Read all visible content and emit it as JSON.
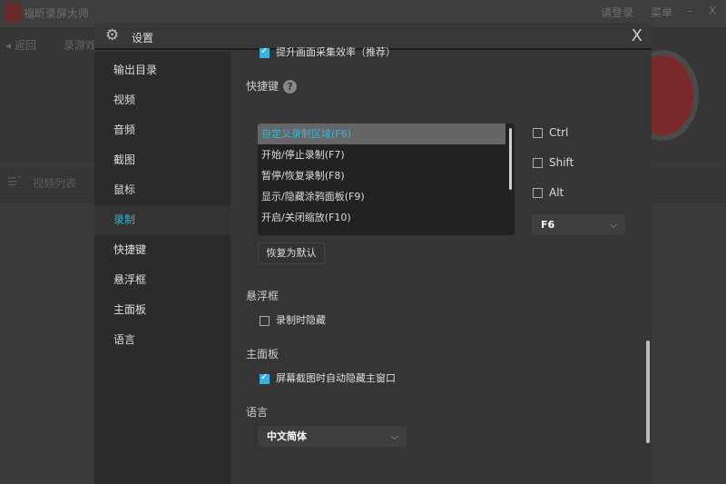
{
  "app": {
    "title": "福昕录屏大师",
    "login": "请登录",
    "menu": "菜单",
    "minimize": "–",
    "close": "X",
    "back": "返回",
    "record_game": "录游戏",
    "video_list": "视频列表"
  },
  "dialog": {
    "title": "设置",
    "close": "X"
  },
  "sidebar": {
    "items": [
      {
        "label": "输出目录"
      },
      {
        "label": "视频"
      },
      {
        "label": "音频"
      },
      {
        "label": "截图"
      },
      {
        "label": "鼠标"
      },
      {
        "label": "录制",
        "active": true
      },
      {
        "label": "快捷键"
      },
      {
        "label": "悬浮框"
      },
      {
        "label": "主面板"
      },
      {
        "label": "语言"
      }
    ]
  },
  "content": {
    "top_option": {
      "label": "提升画面采集效率（推荐）",
      "checked": true
    },
    "hotkeys": {
      "title": "快捷键",
      "help": "?",
      "items": [
        "自定义录制区域(F6)",
        "开始/停止录制(F7)",
        "暂停/恢复录制(F8)",
        "显示/隐藏涂鸦面板(F9)",
        "开启/关闭缩放(F10)"
      ],
      "selected": 0,
      "modifiers": [
        {
          "label": "Ctrl",
          "checked": false
        },
        {
          "label": "Shift",
          "checked": false
        },
        {
          "label": "Alt",
          "checked": false
        }
      ],
      "key": "F6",
      "reset": "恢复为默认"
    },
    "float": {
      "title": "悬浮框",
      "option": {
        "label": "录制时隐藏",
        "checked": false
      }
    },
    "panel": {
      "title": "主面板",
      "option": {
        "label": "屏幕截图时自动隐藏主窗口",
        "checked": true
      }
    },
    "language": {
      "title": "语言",
      "value": "中文简体"
    }
  },
  "colors": {
    "accent": "#2eb8d8",
    "checkbox": "#3ab0e0"
  }
}
